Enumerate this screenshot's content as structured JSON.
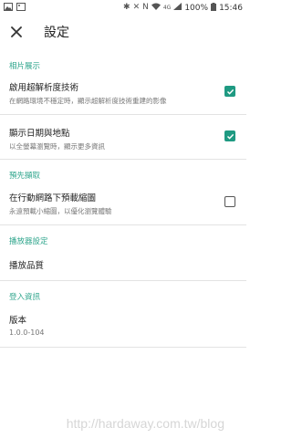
{
  "status_bar": {
    "battery": "100%",
    "time": "15:46",
    "network": "4G"
  },
  "app_bar": {
    "title": "設定"
  },
  "sections": {
    "photo_display": {
      "header": "相片展示",
      "super_res": {
        "title": "啟用超解析度技術",
        "subtitle": "在網路環境不穩定時，顯示超解析度技術重建的影像",
        "checked": true
      },
      "date_location": {
        "title": "顯示日期與地點",
        "subtitle": "以全螢幕瀏覽時，顯示更多資訊",
        "checked": true
      }
    },
    "prefetch": {
      "header": "預先擷取",
      "mobile_thumbnails": {
        "title": "在行動網路下預載縮圖",
        "subtitle": "永遠預載小縮圖，以優化瀏覽體驗",
        "checked": false
      }
    },
    "player": {
      "header": "播放器設定",
      "quality": {
        "title": "播放品質"
      }
    },
    "login": {
      "header": "登入資訊",
      "version": {
        "title": "版本",
        "value": "1.0.0-104"
      }
    }
  },
  "watermark": "http://hardaway.com.tw/blog",
  "colors": {
    "accent": "#2fa58c",
    "checkbox_on": "#1f9a82"
  }
}
